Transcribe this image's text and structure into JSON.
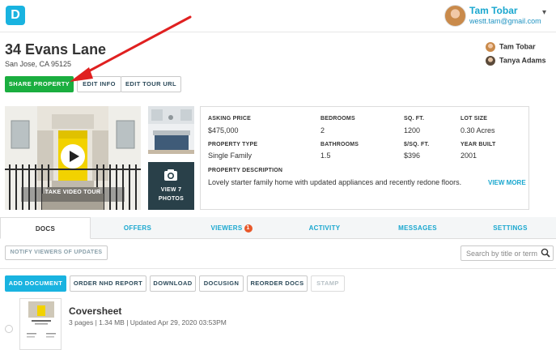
{
  "app": {
    "logo_letter": "D"
  },
  "user": {
    "name": "Tam Tobar",
    "email": "westt.tam@gmail.com"
  },
  "property": {
    "title": "34 Evans Lane",
    "address": "San Jose, CA 95125"
  },
  "actions": {
    "share": "SHARE PROPERTY",
    "edit_info": "EDIT INFO",
    "edit_tour_url": "EDIT TOUR URL"
  },
  "viewers_list": [
    {
      "name": "Tam Tobar"
    },
    {
      "name": "Tanya Adams"
    }
  ],
  "media": {
    "video_label": "TAKE VIDEO TOUR",
    "photos_label_line1": "VIEW 7",
    "photos_label_line2": "PHOTOS"
  },
  "details": {
    "asking_price_label": "ASKING PRICE",
    "asking_price": "$475,000",
    "bedrooms_label": "BEDROOMS",
    "bedrooms": "2",
    "sqft_label": "SQ. FT.",
    "sqft": "1200",
    "lot_size_label": "LOT SIZE",
    "lot_size": "0.30 Acres",
    "property_type_label": "PROPERTY TYPE",
    "property_type": "Single Family",
    "bathrooms_label": "BATHROOMS",
    "bathrooms": "1.5",
    "price_sqft_label": "$/SQ. FT.",
    "price_sqft": "$396",
    "year_built_label": "YEAR BUILT",
    "year_built": "2001",
    "description_label": "PROPERTY DESCRIPTION",
    "description": "Lovely starter family home with updated appliances and recently redone floors.",
    "view_more": "VIEW MORE"
  },
  "tabs": [
    {
      "label": "DOCS",
      "active": true
    },
    {
      "label": "OFFERS"
    },
    {
      "label": "VIEWERS",
      "badge": "1"
    },
    {
      "label": "ACTIVITY"
    },
    {
      "label": "MESSAGES"
    },
    {
      "label": "SETTINGS"
    }
  ],
  "docs": {
    "notify_label": "NOTIFY VIEWERS OF UPDATES",
    "search_placeholder": "Search by title or term",
    "toolbar": {
      "add_document": "ADD DOCUMENT",
      "order_nhd": "ORDER NHD REPORT",
      "download": "DOWNLOAD",
      "docusign": "DOCUSIGN",
      "reorder": "REORDER DOCS",
      "stamp": "STAMP"
    },
    "items": [
      {
        "title": "Coversheet",
        "meta": "3 pages | 1.34 MB | Updated Apr 29, 2020 03:53PM"
      }
    ]
  },
  "colors": {
    "brand": "#19b3e0",
    "share_green": "#1aae3f",
    "badge": "#e8582a",
    "arrow": "#e02020",
    "dark_tile": "#294049"
  },
  "icons": [
    "play-icon",
    "camera-icon",
    "search-icon",
    "chevron-down-icon"
  ]
}
